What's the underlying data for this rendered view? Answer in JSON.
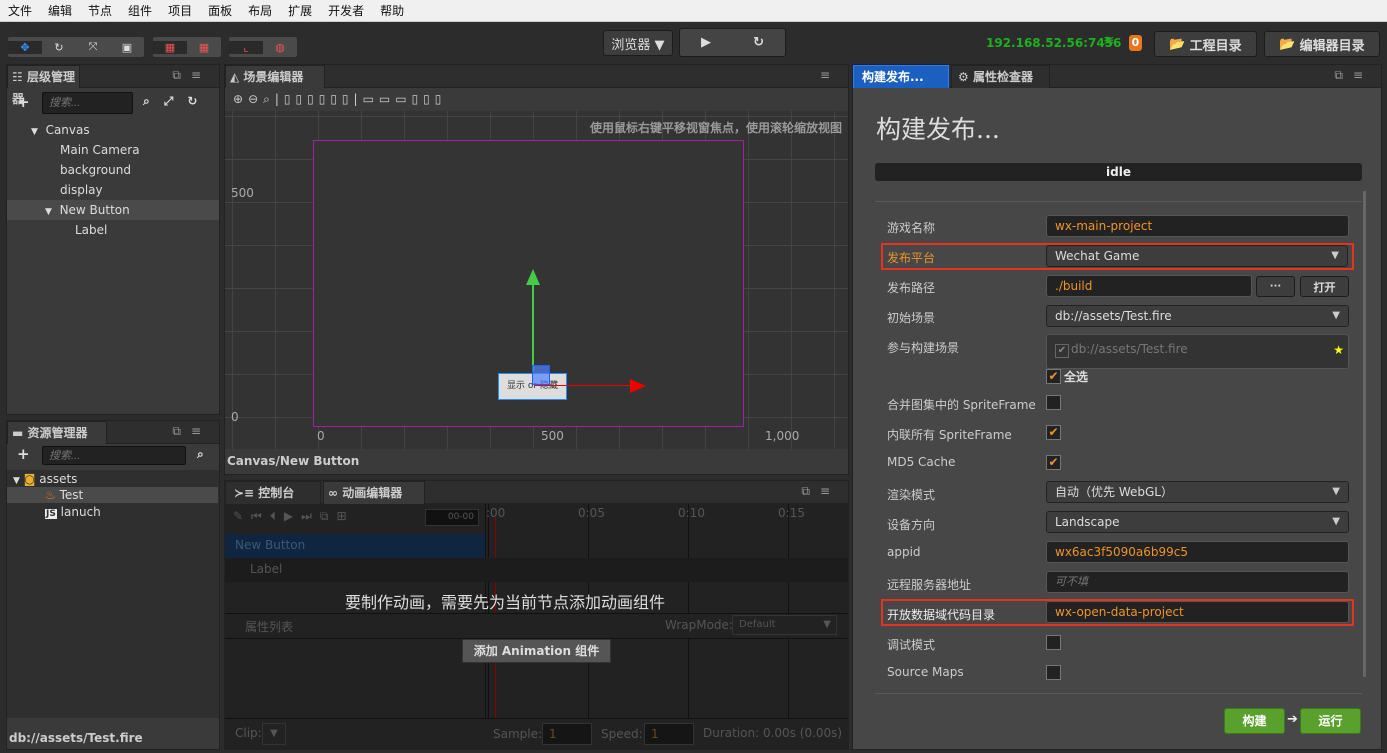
{
  "menu": [
    "文件",
    "编辑",
    "节点",
    "组件",
    "项目",
    "面板",
    "布局",
    "扩展",
    "开发者",
    "帮助"
  ],
  "toolbar": {
    "tools": [
      "move-icon",
      "rotate-icon",
      "scale-icon",
      "rect-icon"
    ],
    "preview_select": "浏览器 ▼",
    "play_icon": "▶",
    "refresh_icon": "↻",
    "ip": "192.168.52.56:7456",
    "wifi_icon": "wifi-icon",
    "notification_count": "0",
    "project_dir": "工程目录",
    "editor_dir": "编辑器目录",
    "accent_green": "#1db01d"
  },
  "hierarchy": {
    "title": "层级管理器",
    "search_placeholder": "搜索...",
    "nodes": [
      {
        "label": "Canvas",
        "depth": 0,
        "expanded": true
      },
      {
        "label": "Main Camera",
        "depth": 1
      },
      {
        "label": "background",
        "depth": 1
      },
      {
        "label": "display",
        "depth": 1
      },
      {
        "label": "New Button",
        "depth": 1,
        "expanded": true,
        "selected": true
      },
      {
        "label": "Label",
        "depth": 2
      }
    ]
  },
  "assets": {
    "title": "资源管理器",
    "search_placeholder": "搜索...",
    "items": [
      {
        "label": "assets",
        "icon": "folder-db-icon"
      },
      {
        "label": "Test",
        "icon": "fire-icon",
        "selected": true
      },
      {
        "label": "lanuch",
        "icon": "js-icon"
      }
    ],
    "status": "db://assets/Test.fire"
  },
  "scene": {
    "title": "场景编辑器",
    "hint": "使用鼠标右键平移视窗焦点，使用滚轮缩放视图",
    "y_labels": [
      "500",
      "0"
    ],
    "x_labels": [
      "0",
      "500",
      "1,000"
    ],
    "button_text": "显示 or 隐藏",
    "breadcrumb": "Canvas/New Button"
  },
  "console": {
    "title": "控制台"
  },
  "animation": {
    "title": "动画编辑器",
    "time_input": "00-00",
    "ticks": [
      ":00",
      "0:05",
      "0:10",
      "0:15"
    ],
    "nodes": [
      "New Button",
      "Label"
    ],
    "message": "要制作动画，需要先为当前节点添加动画组件",
    "props_label": "属性列表",
    "wrapmode_label": "WrapMode:",
    "wrapmode_value": "Default",
    "add_button": "添加 Animation 组件",
    "clip_label": "Clip:",
    "sample_label": "Sample:",
    "sample_value": "1",
    "speed_label": "Speed:",
    "speed_value": "1",
    "duration": "Duration: 0.00s (0.00s)"
  },
  "build": {
    "tab": "构建发布...",
    "inspector_tab": "属性检查器",
    "title": "构建发布...",
    "status": "idle",
    "game_name_label": "游戏名称",
    "game_name": "wx-main-project",
    "platform_label": "发布平台",
    "platform": "Wechat Game",
    "path_label": "发布路径",
    "path": "./build",
    "browse": "···",
    "open": "打开",
    "start_scene_label": "初始场景",
    "start_scene": "db://assets/Test.fire",
    "scenes_label": "参与构建场景",
    "scene_item": "db://assets/Test.fire",
    "select_all": "全选",
    "merge_label": "合并图集中的 SpriteFrame",
    "merge": false,
    "inline_label": "内联所有 SpriteFrame",
    "inline": true,
    "md5_label": "MD5 Cache",
    "md5": true,
    "render_label": "渲染模式",
    "render": "自动（优先 WebGL）",
    "orientation_label": "设备方向",
    "orientation": "Landscape",
    "appid_label": "appid",
    "appid": "wx6ac3f5090a6b99c5",
    "remote_label": "远程服务器地址",
    "remote_placeholder": "可不填",
    "open_data_label": "开放数据域代码目录",
    "open_data": "wx-open-data-project",
    "debug_label": "调试模式",
    "debug": false,
    "sourcemap_label": "Source Maps",
    "sourcemap": false,
    "build_btn": "构建",
    "run_btn": "运行",
    "highlight_color": "#e8321e"
  }
}
